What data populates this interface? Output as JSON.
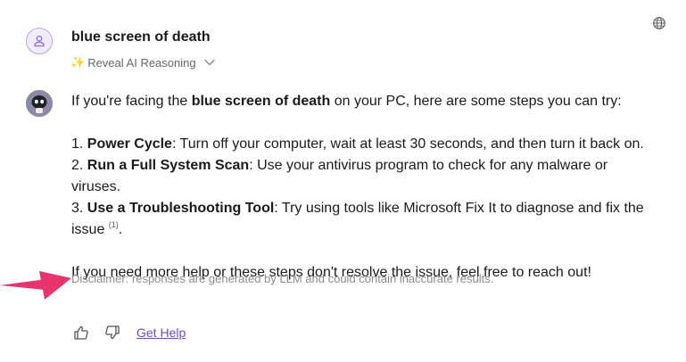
{
  "user_message": {
    "text": "blue screen of death",
    "reasoning_label": "Reveal AI Reasoning",
    "reasoning_icon": "✨"
  },
  "answer": {
    "intro_before": "If you're facing the ",
    "intro_bold": "blue screen of death",
    "intro_after": " on your PC, here are some steps you can try:",
    "steps": [
      {
        "number": "1. ",
        "title": "Power Cycle",
        "text": ": Turn off your computer, wait at least 30 seconds, and then turn it back on."
      },
      {
        "number": "2. ",
        "title": "Run a Full System Scan",
        "text": ": Use your antivirus program to check for any malware or viruses."
      },
      {
        "number": "3. ",
        "title": "Use a Troubleshooting Tool",
        "text": ": Try using tools like Microsoft Fix It to diagnose and fix the issue ",
        "citation": "(1)",
        "tail": "."
      }
    ],
    "closing": "If you need more help or these steps don't resolve the issue, feel free to reach out!"
  },
  "disclaimer": "Disclaimer: responses are generated by LLM and could contain inaccurate results.",
  "actions": {
    "get_help": "Get Help"
  },
  "colors": {
    "accent": "#6b4fbb",
    "arrow": "#e8336d",
    "bot_avatar": "#8e8aa6"
  }
}
